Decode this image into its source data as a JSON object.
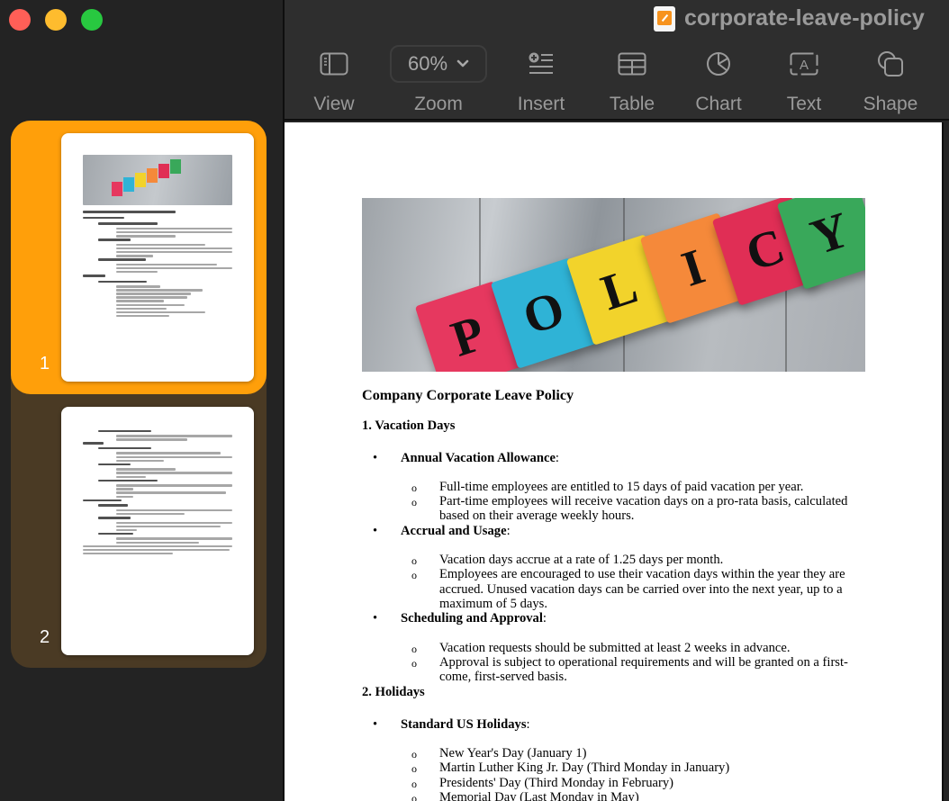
{
  "window": {
    "title": "corporate-leave-policy",
    "traffic_lights": [
      "close",
      "minimize",
      "zoom"
    ]
  },
  "toolbar": {
    "items": [
      {
        "label": "View",
        "icon": "sidebar-view-icon"
      },
      {
        "label": "Zoom",
        "icon": "chevron-down-icon",
        "value": "60%"
      },
      {
        "label": "Insert",
        "icon": "insert-list-icon"
      },
      {
        "label": "Table",
        "icon": "table-icon"
      },
      {
        "label": "Chart",
        "icon": "pie-chart-icon"
      },
      {
        "label": "Text",
        "icon": "text-box-icon"
      },
      {
        "label": "Shape",
        "icon": "shape-icon"
      }
    ],
    "zoom_value": "60%"
  },
  "sidebar": {
    "pages": [
      {
        "number": "1",
        "selected": true
      },
      {
        "number": "2",
        "selected": false
      }
    ],
    "selected_color": "#ff9f0a"
  },
  "document": {
    "hero_image": {
      "alt": "POLICY letter cubes",
      "letters": [
        "P",
        "O",
        "L",
        "I",
        "C",
        "Y"
      ],
      "cube_colors": [
        "#e6385f",
        "#2fb3d6",
        "#f2d32b",
        "#f5893a",
        "#e02e55",
        "#39a85a"
      ]
    },
    "title": "Company Corporate Leave Policy",
    "sections": [
      {
        "heading": "1. Vacation Days",
        "items": [
          {
            "label": "Annual Vacation Allowance",
            "bullets": [
              "Full-time employees are entitled to 15 days of paid vacation per year.",
              "Part-time employees will receive vacation days on a pro-rata basis, calculated based on their average weekly hours."
            ]
          },
          {
            "label": "Accrual and Usage",
            "bullets": [
              "Vacation days accrue at a rate of 1.25 days per month.",
              "Employees are encouraged to use their vacation days within the year they are accrued. Unused vacation days can be carried over into the next year, up to a maximum of 5 days."
            ]
          },
          {
            "label": "Scheduling and Approval",
            "bullets": [
              "Vacation requests should be submitted at least 2 weeks in advance.",
              "Approval is subject to operational requirements and will be granted on a first-come, first-served basis."
            ]
          }
        ]
      },
      {
        "heading": "2. Holidays",
        "items": [
          {
            "label": "Standard US Holidays",
            "bullets": [
              "New Year's Day (January 1)",
              "Martin Luther King Jr. Day (Third Monday in January)",
              "Presidents' Day (Third Monday in February)",
              "Memorial Day (Last Monday in May)"
            ]
          }
        ]
      }
    ]
  },
  "colon": ":",
  "bullet_l1": "•",
  "bullet_l2": "o"
}
